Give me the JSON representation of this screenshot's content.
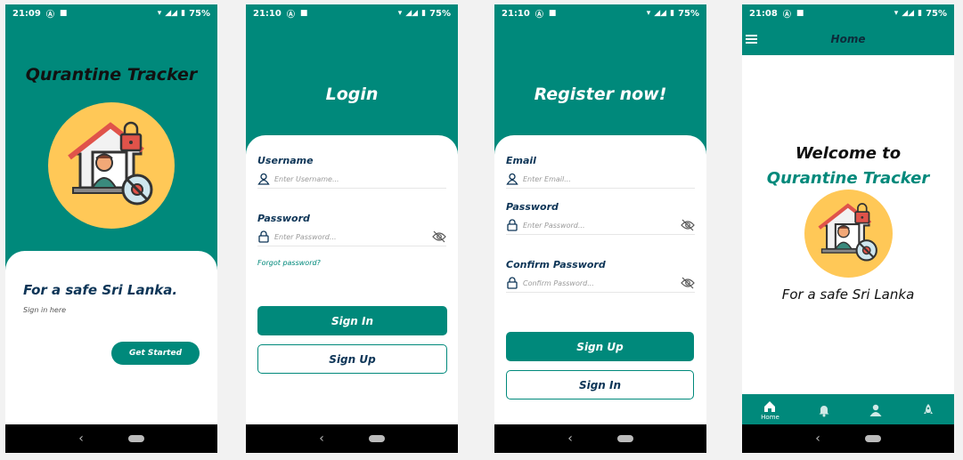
{
  "screens": {
    "splash": {
      "status": {
        "time": "21:09",
        "battery": "75%"
      },
      "title": "Qurantine Tracker",
      "tagline": "For a safe Sri Lanka.",
      "subtitle": "Sign in here",
      "button": "Get Started"
    },
    "login": {
      "status": {
        "time": "21:10",
        "battery": "75%"
      },
      "title": "Login",
      "username_label": "Username",
      "username_placeholder": "Enter Username...",
      "password_label": "Password",
      "password_placeholder": "Enter Password...",
      "forgot": "Forgot password?",
      "signin": "Sign In",
      "signup": "Sign Up"
    },
    "register": {
      "status": {
        "time": "21:10",
        "battery": "75%"
      },
      "title": "Register now!",
      "email_label": "Email",
      "email_placeholder": "Enter Email...",
      "password_label": "Password",
      "password_placeholder": "Enter Password...",
      "confirm_label": "Confirm Password",
      "confirm_placeholder": "Confirm Password...",
      "signup": "Sign Up",
      "signin": "Sign In"
    },
    "home": {
      "status": {
        "time": "21:08",
        "battery": "75%"
      },
      "title": "Home",
      "welcome": "Welcome to",
      "brand": "Qurantine Tracker",
      "tagline": "For a safe Sri Lanka",
      "nav": [
        {
          "label": "Home",
          "icon": "home-icon"
        },
        {
          "label": "",
          "icon": "bell-icon"
        },
        {
          "label": "",
          "icon": "person-icon"
        },
        {
          "label": "",
          "icon": "rocket-icon"
        }
      ]
    }
  },
  "colors": {
    "primary": "#00897b",
    "accent": "#ffc857",
    "text_dark": "#0d3557"
  }
}
